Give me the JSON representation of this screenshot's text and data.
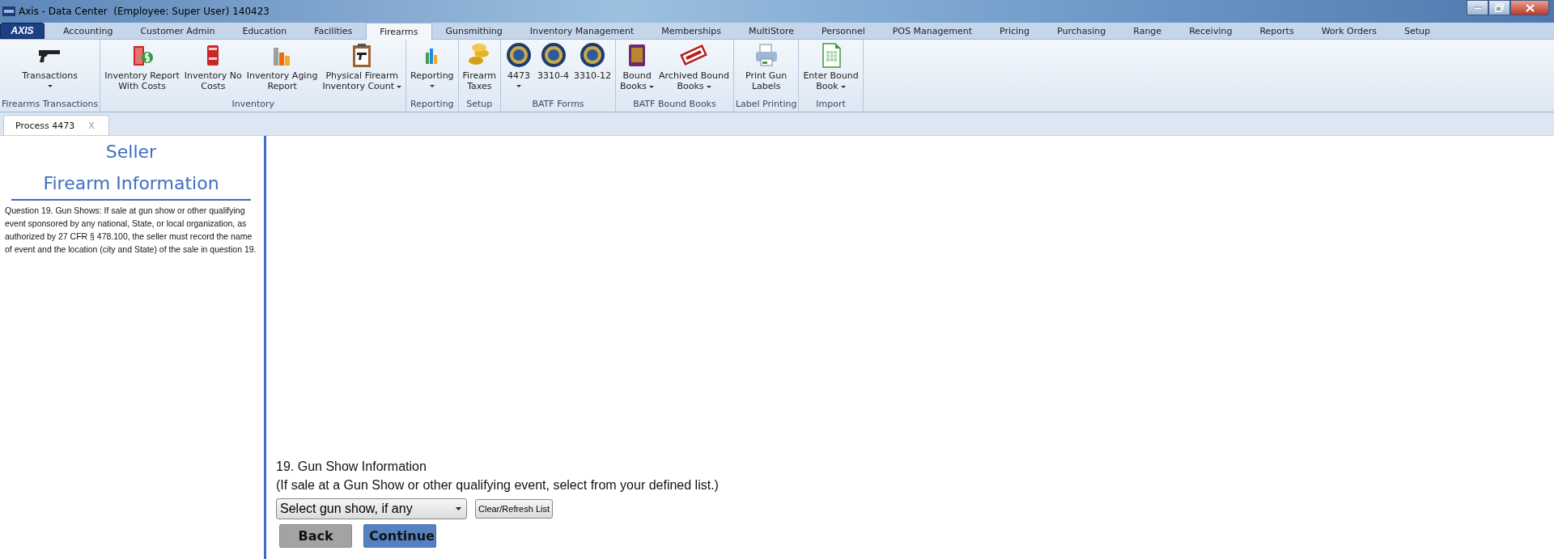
{
  "window": {
    "title": "Axis - Data Center  (Employee: Super User) 140423"
  },
  "app_button": "AXIS",
  "tabs": [
    {
      "label": "Accounting",
      "selected": false
    },
    {
      "label": "Customer Admin",
      "selected": false
    },
    {
      "label": "Education",
      "selected": false
    },
    {
      "label": "Facilities",
      "selected": false
    },
    {
      "label": "Firearms",
      "selected": true
    },
    {
      "label": "Gunsmithing",
      "selected": false
    },
    {
      "label": "Inventory Management",
      "selected": false
    },
    {
      "label": "Memberships",
      "selected": false
    },
    {
      "label": "MultiStore",
      "selected": false
    },
    {
      "label": "Personnel",
      "selected": false
    },
    {
      "label": "POS Management",
      "selected": false
    },
    {
      "label": "Pricing",
      "selected": false
    },
    {
      "label": "Purchasing",
      "selected": false
    },
    {
      "label": "Range",
      "selected": false
    },
    {
      "label": "Receiving",
      "selected": false
    },
    {
      "label": "Reports",
      "selected": false
    },
    {
      "label": "Work Orders",
      "selected": false
    },
    {
      "label": "Setup",
      "selected": false
    }
  ],
  "ribbon_groups": [
    {
      "label": "Firearms Transactions",
      "buttons": [
        {
          "kind": "pistol",
          "label": "Transactions",
          "dropdown": true
        }
      ]
    },
    {
      "label": "Inventory",
      "buttons": [
        {
          "kind": "money-book",
          "label": "Inventory Report\nWith Costs",
          "dropdown": false
        },
        {
          "kind": "book",
          "label": "Inventory No\nCosts",
          "dropdown": false
        },
        {
          "kind": "bars",
          "label": "Inventory Aging\nReport",
          "dropdown": false
        },
        {
          "kind": "clipboard",
          "label": "Physical Firearm\nInventory Count",
          "dropdown": true
        }
      ]
    },
    {
      "label": "Reporting",
      "buttons": [
        {
          "kind": "small-bars",
          "label": "Reporting",
          "dropdown": true
        }
      ]
    },
    {
      "label": "Setup",
      "buttons": [
        {
          "kind": "coins",
          "label": "Firearm\nTaxes",
          "dropdown": false
        }
      ]
    },
    {
      "label": "BATF Forms",
      "buttons": [
        {
          "kind": "seal",
          "label": "4473",
          "dropdown": true
        },
        {
          "kind": "seal",
          "label": "3310-4",
          "dropdown": false
        },
        {
          "kind": "seal",
          "label": "3310-12",
          "dropdown": false
        }
      ]
    },
    {
      "label": "BATF Bound Books",
      "buttons": [
        {
          "kind": "atf-book",
          "label": "Bound\nBooks",
          "dropdown": true
        },
        {
          "kind": "stamp",
          "label": "Archived Bound\nBooks",
          "dropdown": true
        }
      ]
    },
    {
      "label": "Label Printing",
      "buttons": [
        {
          "kind": "printer",
          "label": "Print Gun\nLabels",
          "dropdown": false
        }
      ]
    },
    {
      "label": "Import",
      "buttons": [
        {
          "kind": "spreadsheet",
          "label": "Enter Bound\nBook",
          "dropdown": true
        }
      ]
    }
  ],
  "document_tabs": [
    {
      "label": "Process 4473",
      "close": "X",
      "selected": true
    }
  ],
  "sidebar": {
    "heading": "Seller",
    "title": "Firearm Information",
    "text": "Question 19.  Gun Shows:  If sale at gun show or other qualifying event sponsored by any national, State, or local organization, as authorized by 27 CFR § 478.100, the seller must record the name of event  and the location (city and State) of the sale in question 19."
  },
  "form": {
    "question": "19. Gun Show Information",
    "hint": "(If sale at a Gun Show or other qualifying event, select from your defined list.)",
    "select": {
      "value": "Select gun show, if any"
    },
    "refresh_button": "Clear/Refresh List",
    "buttons": [
      {
        "label": "Back",
        "kind": "secondary"
      },
      {
        "label": "Continue",
        "kind": "primary"
      }
    ]
  }
}
